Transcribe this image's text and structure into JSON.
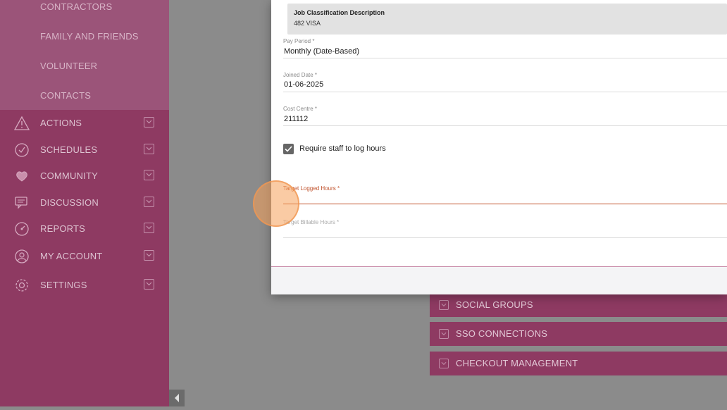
{
  "sidebar": {
    "sub_items": [
      "CONTRACTORS",
      "FAMILY AND FRIENDS",
      "VOLUNTEER",
      "CONTACTS"
    ],
    "items": [
      {
        "label": "ACTIONS",
        "icon": "warning-icon"
      },
      {
        "label": "SCHEDULES",
        "icon": "clock-icon"
      },
      {
        "label": "COMMUNITY",
        "icon": "hearts-icon"
      },
      {
        "label": "DISCUSSION",
        "icon": "chat-icon"
      },
      {
        "label": "REPORTS",
        "icon": "gauge-icon"
      },
      {
        "label": "MY ACCOUNT",
        "icon": "user-icon"
      },
      {
        "label": "SETTINGS",
        "icon": "gear-icon"
      }
    ]
  },
  "sections": [
    "SOCIAL GROUPS",
    "SSO CONNECTIONS",
    "CHECKOUT MANAGEMENT"
  ],
  "modal": {
    "job_classification": {
      "label": "Job Classification Description",
      "value": "482 VISA"
    },
    "pay_period": {
      "label": "Pay Period *",
      "value": "Monthly (Date-Based)"
    },
    "joined_date": {
      "label": "Joined Date *",
      "value": "01-06-2025"
    },
    "cost_centre": {
      "label": "Cost Centre *",
      "value": "211112"
    },
    "require_log": {
      "label": "Require staff to log hours",
      "checked": true
    },
    "target_logged": {
      "label": "Target Logged Hours *",
      "value": ""
    },
    "target_billable": {
      "label": "Target Billable Hours *",
      "value": ""
    }
  },
  "colors": {
    "sidebar": "#8e3a62",
    "accent_error": "#c0502a"
  }
}
